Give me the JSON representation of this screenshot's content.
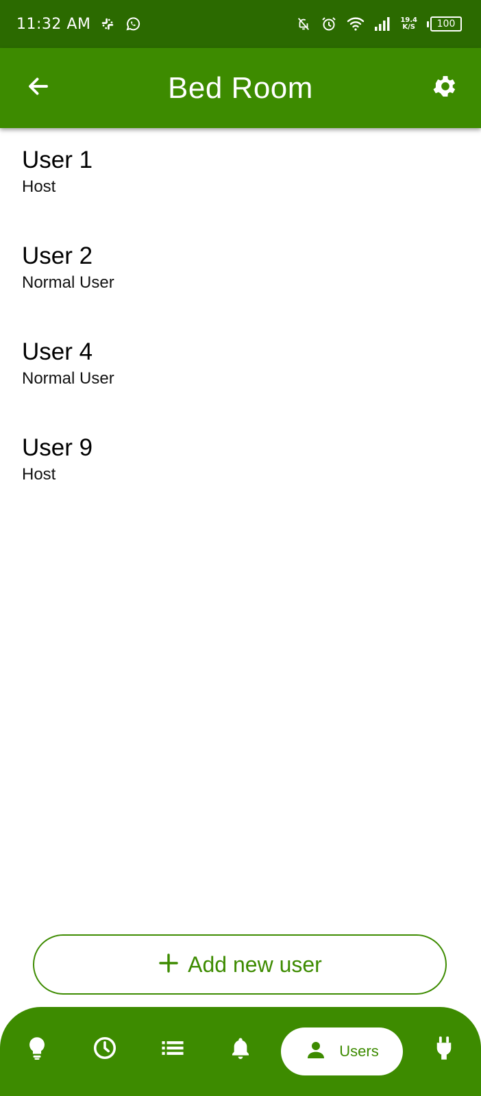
{
  "status_bar": {
    "time": "11:32 AM",
    "net_speed_value": "19.4",
    "net_speed_unit": "K/S",
    "battery": "100",
    "icons": [
      "slack-icon",
      "whatsapp-icon",
      "notifications-off-icon",
      "alarm-icon",
      "wifi-icon",
      "signal-icon"
    ]
  },
  "app_bar": {
    "title": "Bed Room",
    "back_icon": "arrow-back-icon",
    "settings_icon": "gear-icon"
  },
  "users": [
    {
      "name": "User 1",
      "role": "Host"
    },
    {
      "name": "User 2",
      "role": "Normal User"
    },
    {
      "name": "User 4",
      "role": "Normal User"
    },
    {
      "name": "User 9",
      "role": "Host"
    }
  ],
  "add_user": {
    "label": "Add new user",
    "icon": "plus-icon"
  },
  "bottom_nav": {
    "items": [
      {
        "icon": "lightbulb-icon"
      },
      {
        "icon": "clock-icon"
      },
      {
        "icon": "list-icon"
      },
      {
        "icon": "bell-icon"
      },
      {
        "icon": "person-icon",
        "label": "Users",
        "active": true
      },
      {
        "icon": "plug-icon"
      }
    ]
  },
  "colors": {
    "status_bar": "#2b6a00",
    "primary": "#3d8b00",
    "background": "#ffffff"
  }
}
